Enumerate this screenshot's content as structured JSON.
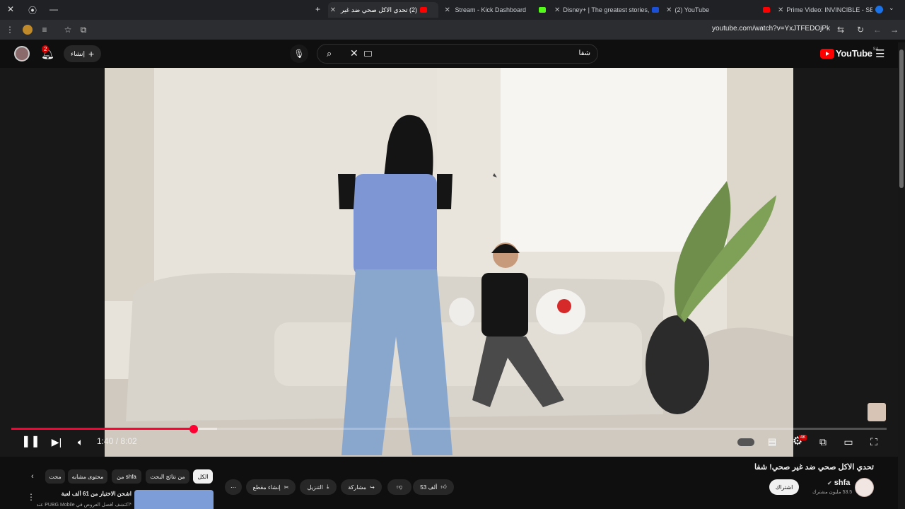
{
  "browser": {
    "tabs": [
      {
        "title": "(2) تحدي الاكل صحي ضد غير",
        "favicon_color": "#ff0000",
        "active": true
      },
      {
        "title": "Stream - Kick Dashboard",
        "favicon_color": "#53fc18",
        "active": false
      },
      {
        "title": "Disney+ | The greatest stories,",
        "favicon_color": "#1b4fd6",
        "active": false
      },
      {
        "title": "(2) YouTube",
        "favicon_color": "#ff0000",
        "active": false
      },
      {
        "title": "Prime Video: INVINCIBLE - SEA",
        "favicon_color": "#00a8e1",
        "active": false
      }
    ],
    "new_tab_symbol": "+",
    "url": "youtube.com/watch?v=YxJTFEDOjPk",
    "icons": [
      "close-icon",
      "record-icon",
      "minimize-icon",
      "menu-dots-icon",
      "extension-icon",
      "reading-list-icon",
      "bookmark-star-icon",
      "cast-icon",
      "reload-icon",
      "back-icon",
      "forward-icon"
    ]
  },
  "masthead": {
    "logo_text": "YouTube",
    "region": "SA",
    "search_value": "شفا",
    "create_label": "إنشاء",
    "notification_count": "2"
  },
  "player": {
    "time_display": "1:40 / 8:02",
    "progress_fraction": 0.208,
    "buffer_fraction": 0.235,
    "quality_badge": "4K",
    "accent": "#ff0033"
  },
  "video": {
    "title": "تحدي الاكل صحي ضد غير صحي! شفا",
    "channel": "shfa",
    "verified_symbol": "✔",
    "subscribers": "53.5 مليون مشترك",
    "subscribe_label": "اشتراك",
    "likes": "53 ألف",
    "share_label": "مشاركة",
    "download_label": "التنزيل",
    "clip_label": "إنشاء مقطع",
    "more_symbol": "⋯"
  },
  "chips": [
    {
      "label": "الكل",
      "selected": true
    },
    {
      "label": "من نتائج البحث",
      "selected": false
    },
    {
      "label": "من shfa",
      "selected": false
    },
    {
      "label": "محتوى مشابه",
      "selected": false
    },
    {
      "label": "محت",
      "selected": false
    }
  ],
  "recommendation": {
    "title": "اشحن الاختيار من 61 ألف لعبة",
    "subtitle": "*اكتشف أفضل العروض في PUBG Mobile عند"
  }
}
